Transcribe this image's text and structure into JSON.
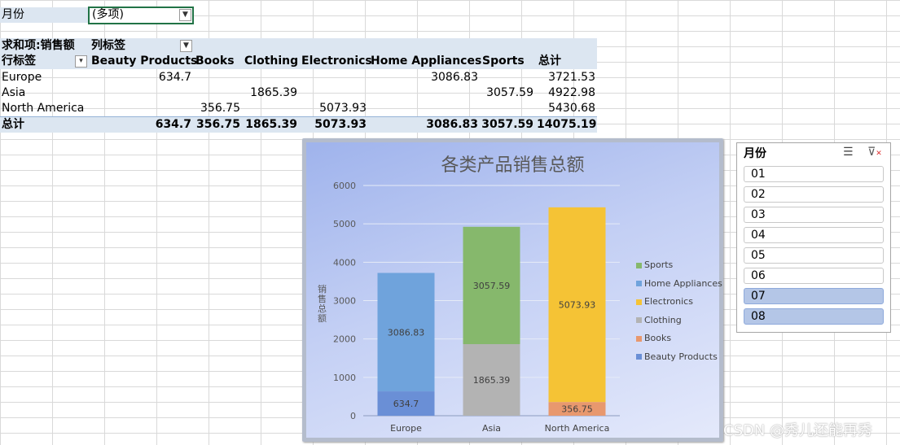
{
  "filter": {
    "label": "月份",
    "value": "(多项)"
  },
  "pivot": {
    "value_label": "求和项:销售额",
    "col_label": "列标签",
    "row_label": "行标签",
    "columns": [
      "Beauty Products",
      "Books",
      "Clothing",
      "Electronics",
      "Home Appliances",
      "Sports",
      "总计"
    ],
    "rows": [
      {
        "label": "Europe",
        "values": [
          "634.7",
          "",
          "",
          "",
          "3086.83",
          "",
          "3721.53"
        ]
      },
      {
        "label": "Asia",
        "values": [
          "",
          "",
          "1865.39",
          "",
          "",
          "3057.59",
          "4922.98"
        ]
      },
      {
        "label": "North America",
        "values": [
          "",
          "356.75",
          "",
          "5073.93",
          "",
          "",
          "5430.68"
        ]
      }
    ],
    "total": {
      "label": "总计",
      "values": [
        "634.7",
        "356.75",
        "1865.39",
        "5073.93",
        "3086.83",
        "3057.59",
        "14075.19"
      ]
    }
  },
  "chart_data": {
    "type": "bar",
    "stacked": true,
    "title": "各类产品销售总额",
    "xlabel": "",
    "ylabel": "销售总额",
    "ylim": [
      0,
      6000
    ],
    "yticks": [
      0,
      1000,
      2000,
      3000,
      4000,
      5000,
      6000
    ],
    "grid": true,
    "legend_position": "right",
    "categories": [
      "Europe",
      "Asia",
      "North America"
    ],
    "series": [
      {
        "name": "Beauty Products",
        "color": "#6a8fd6",
        "values": [
          634.7,
          0,
          0
        ]
      },
      {
        "name": "Books",
        "color": "#e8986e",
        "values": [
          0,
          0,
          356.75
        ]
      },
      {
        "name": "Clothing",
        "color": "#b3b3b3",
        "values": [
          0,
          1865.39,
          0
        ]
      },
      {
        "name": "Electronics",
        "color": "#f5c335",
        "values": [
          0,
          0,
          5073.93
        ]
      },
      {
        "name": "Home Appliances",
        "color": "#6fa3dc",
        "values": [
          3086.83,
          0,
          0
        ]
      },
      {
        "name": "Sports",
        "color": "#86b86c",
        "values": [
          0,
          3057.59,
          0
        ]
      }
    ]
  },
  "slicer": {
    "title": "月份",
    "multiselect_icon": "multi-select-icon",
    "clear_icon": "clear-filter-icon",
    "items": [
      {
        "label": "01",
        "selected": false
      },
      {
        "label": "02",
        "selected": false
      },
      {
        "label": "03",
        "selected": false
      },
      {
        "label": "04",
        "selected": false
      },
      {
        "label": "05",
        "selected": false
      },
      {
        "label": "06",
        "selected": false
      },
      {
        "label": "07",
        "selected": true
      },
      {
        "label": "08",
        "selected": true
      }
    ]
  },
  "watermark": "CSDN @秀儿还能再秀"
}
